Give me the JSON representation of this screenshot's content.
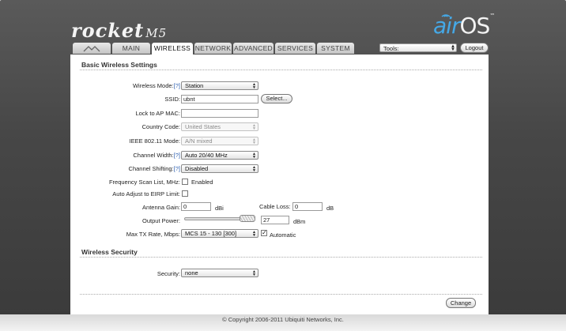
{
  "branding": {
    "product": "rocket",
    "model": "M5",
    "os_prefix": "air",
    "os_suffix": "OS",
    "trademark": "™"
  },
  "tabs": [
    {
      "label": ""
    },
    {
      "label": "MAIN"
    },
    {
      "label": "WIRELESS"
    },
    {
      "label": "NETWORK"
    },
    {
      "label": "ADVANCED"
    },
    {
      "label": "SERVICES"
    },
    {
      "label": "SYSTEM"
    }
  ],
  "header": {
    "tools_label": "Tools:",
    "logout_label": "Logout"
  },
  "basic": {
    "title": "Basic Wireless Settings",
    "help": "[?]",
    "wireless_mode": {
      "label": "Wireless Mode:",
      "value": "Station"
    },
    "ssid": {
      "label": "SSID:",
      "value": "ubnt",
      "select_button": "Select..."
    },
    "lock_mac": {
      "label": "Lock to AP MAC:",
      "value": ""
    },
    "country": {
      "label": "Country Code:",
      "value": "United States"
    },
    "ieee": {
      "label": "IEEE 802.11 Mode:",
      "value": "A/N mixed"
    },
    "channel_width": {
      "label": "Channel Width:",
      "value": "Auto 20/40 MHz"
    },
    "channel_shifting": {
      "label": "Channel Shifting:",
      "value": "Disabled"
    },
    "freq_scan": {
      "label": "Frequency Scan List, MHz:",
      "checkbox_label": "Enabled"
    },
    "eirp": {
      "label": "Auto Adjust to EIRP Limit:"
    },
    "antenna_gain": {
      "label": "Antenna Gain:",
      "value": "0",
      "unit": "dBi"
    },
    "cable_loss": {
      "label": "Cable Loss:",
      "value": "0",
      "unit": "dB"
    },
    "output_power": {
      "label": "Output Power:",
      "value": "27",
      "unit": "dBm",
      "level": 1.0
    },
    "max_tx": {
      "label": "Max TX Rate, Mbps:",
      "value": "MCS 15 - 130 [300]",
      "auto_label": "Automatic",
      "auto_checked": true
    }
  },
  "security": {
    "title": "Wireless Security",
    "label": "Security:",
    "value": "none"
  },
  "actions": {
    "change_label": "Change"
  },
  "footer": {
    "copyright": "© Copyright 2006-2011 Ubiquiti Networks, Inc."
  },
  "colors": {
    "accent_blue": "#45a8e6",
    "help_link": "#2a5db0",
    "frame": "#474747"
  },
  "icons": {
    "brand_logo": "ubiquiti-logo-icon",
    "wifi": "wifi-icon",
    "select_arrow": "select-arrows-icon",
    "checkmark": "checkmark-icon"
  }
}
